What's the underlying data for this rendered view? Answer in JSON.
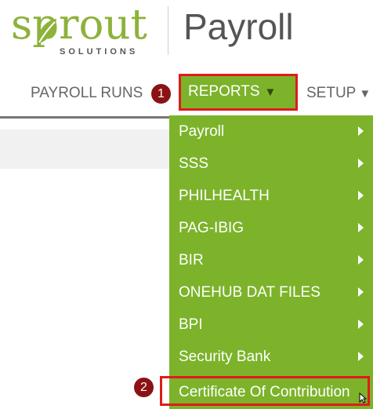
{
  "logo": {
    "word": "sprout",
    "subtitle": "SOLUTIONS"
  },
  "app_title": "Payroll",
  "nav": {
    "payroll_runs": "PAYROLL RUNS",
    "reports": "REPORTS",
    "setup": "SETUP"
  },
  "reports_menu": {
    "items": [
      {
        "label": "Payroll"
      },
      {
        "label": "SSS"
      },
      {
        "label": "PHILHEALTH"
      },
      {
        "label": "PAG-IBIG"
      },
      {
        "label": "BIR"
      },
      {
        "label": "ONEHUB DAT FILES"
      },
      {
        "label": "BPI"
      },
      {
        "label": "Security Bank"
      },
      {
        "label": "Certificate Of Contribution"
      }
    ]
  },
  "annotations": {
    "step1": "1",
    "step2": "2"
  },
  "colors": {
    "brand_green": "#7cb32a",
    "logo_green": "#8db23b",
    "highlight_red": "#e01b1b",
    "badge_red": "#8b1313"
  },
  "icons": [
    "leaf-icon",
    "caret-down-icon",
    "chevron-right-icon",
    "mouse-cursor-icon"
  ]
}
